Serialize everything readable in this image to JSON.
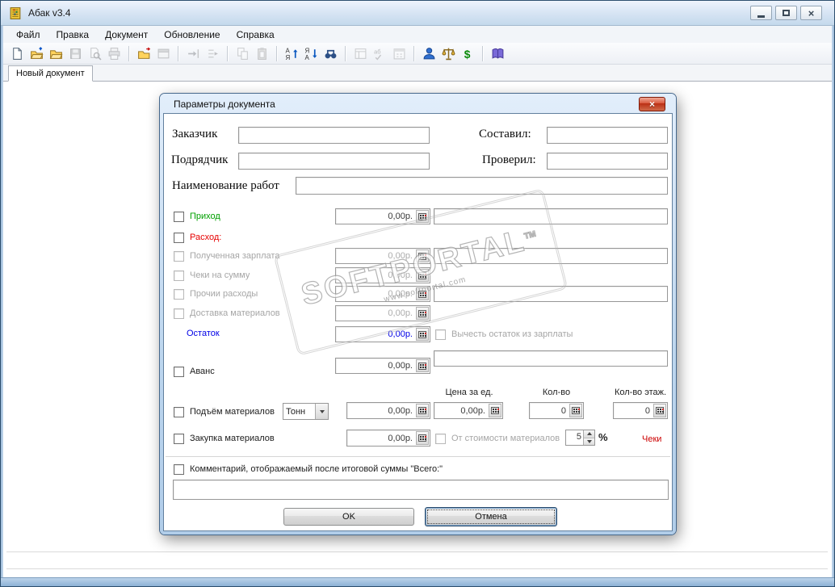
{
  "window": {
    "title": "Абак v3.4"
  },
  "menu": {
    "items": [
      "Файл",
      "Правка",
      "Документ",
      "Обновление",
      "Справка"
    ]
  },
  "toolbar": {
    "icons": [
      "new-document",
      "open-import",
      "open-folder",
      "save",
      "print-preview",
      "print",
      "export-folder",
      "window-view",
      "move-right",
      "merge-rows",
      "copy",
      "paste",
      "sort-ascending",
      "sort-descending",
      "find",
      "report",
      "spell-check",
      "calendar",
      "user",
      "scales",
      "currency-dollar",
      "help-book"
    ]
  },
  "tabs": {
    "active": "Новый документ"
  },
  "dialog": {
    "title": "Параметры документа",
    "labels": {
      "customer": "Заказчик",
      "compiler": "Составил:",
      "contractor": "Подрядчик",
      "checker": "Проверил:",
      "work_name": "Наименование работ",
      "income": "Приход",
      "expense": "Расход:",
      "salary": "Полученная зарплата",
      "receipts_sum": "Чеки на сумму",
      "other_expenses": "Прочии расходы",
      "delivery": "Доставка материалов",
      "remainder": "Остаток",
      "deduct_remainder": "Вычесть остаток из зарплаты",
      "advance": "Аванс",
      "lifting": "Подъём материалов",
      "price_per_unit": "Цена за ед.",
      "quantity": "Кол-во",
      "floors": "Кол-во этаж.",
      "purchase": "Закупка материалов",
      "of_materials_cost": "От стоимости материалов",
      "percent_sign": "%",
      "receipts_link": "Чеки",
      "comment": "Комментарий, отображаемый после итоговой суммы \"Всего:\""
    },
    "values": {
      "money_zero": "0,00р.",
      "unit": "Тонн",
      "quantity": "0",
      "floors": "0",
      "percent": "5"
    },
    "buttons": {
      "ok": "OK",
      "cancel": "Отмена"
    }
  },
  "watermark": {
    "title": "SOFTPORTAL",
    "tm": "TM",
    "url": "www.softportal.com"
  }
}
